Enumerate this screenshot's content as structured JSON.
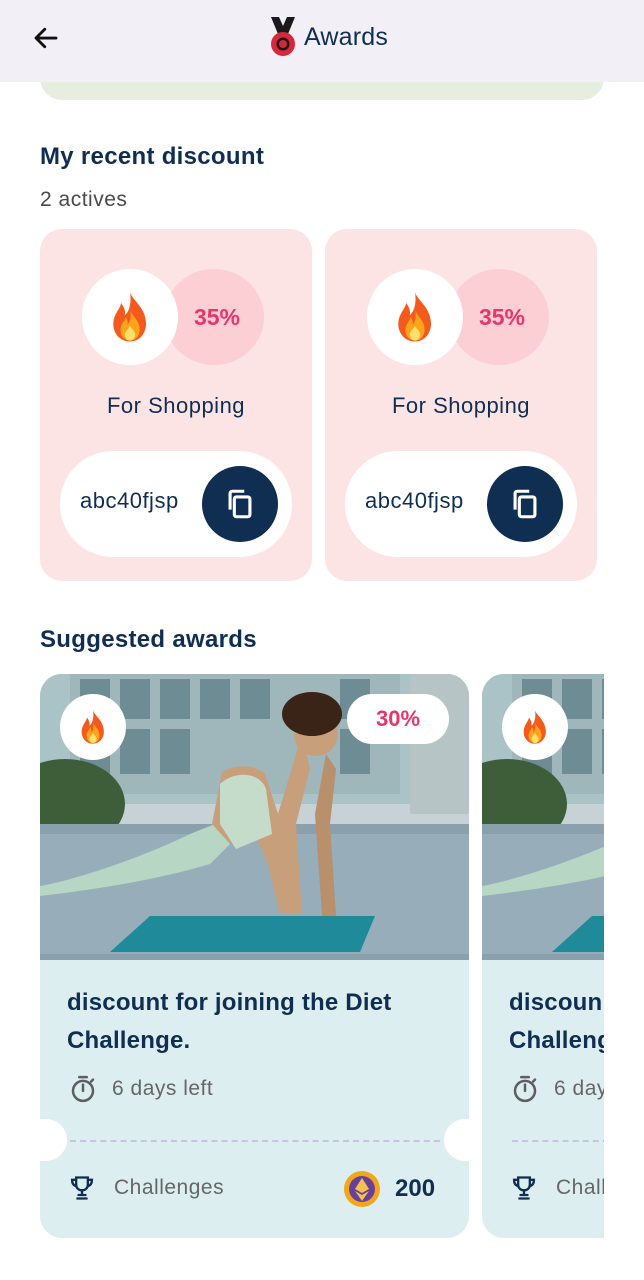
{
  "header": {
    "title": "Awards",
    "back_icon": "arrow-left-icon",
    "title_icon": "medal-icon"
  },
  "recent": {
    "title": "My recent discount",
    "subtitle": "2 actives",
    "cards": [
      {
        "icon": "fire-icon",
        "percent": "35%",
        "label": "For Shopping",
        "code": "abc40fjsp",
        "copy_icon": "copy-icon"
      },
      {
        "icon": "fire-icon",
        "percent": "35%",
        "label": "For Shopping",
        "code": "abc40fjsp",
        "copy_icon": "copy-icon"
      }
    ]
  },
  "suggested": {
    "title": "Suggested awards",
    "cards": [
      {
        "icon": "fire-icon",
        "percent": "30%",
        "title": "discount for joining the Diet Challenge.",
        "days_left": "6 days left",
        "category": "Challenges",
        "points": "200"
      },
      {
        "icon": "fire-icon",
        "title_partial": "discoun Challeng",
        "days_left_partial": "6 day",
        "category_partial": "Chall"
      }
    ]
  },
  "colors": {
    "navy": "#0f2e52",
    "pink_accent": "#e8356d",
    "discount_card_bg": "#fde4e4",
    "award_card_bg": "#dceef0",
    "appbar_bg": "#f2eff6"
  }
}
